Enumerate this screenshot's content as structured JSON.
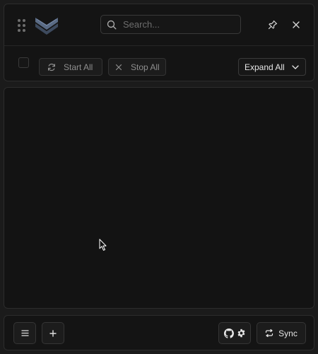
{
  "header": {
    "search": {
      "placeholder": "Search...",
      "value": ""
    },
    "icons": [
      "drag-handle-icon",
      "app-logo-icon",
      "search-icon",
      "pin-icon",
      "close-icon"
    ]
  },
  "toolbar": {
    "select_all_checked": false,
    "start_all_label": "Start All",
    "stop_all_label": "Stop All",
    "expand_all_label": "Expand All"
  },
  "footer": {
    "sync_label": "Sync",
    "icons": [
      "menu-icon",
      "plus-icon",
      "github-icon",
      "gear-icon",
      "sync-icon"
    ]
  },
  "colors": {
    "background": "#1b1b1b",
    "panel": "#141414",
    "border": "#2c2c2c",
    "logo_accent": "#5a6b85"
  }
}
